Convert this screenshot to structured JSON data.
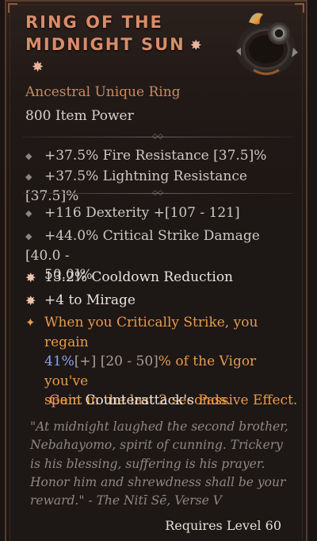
{
  "item": {
    "name": "Ring of the Midnight Sun",
    "name_line1": "RING OF THE",
    "name_line2": "MIDNIGHT SUN",
    "type": "Ancestral Unique Ring",
    "power": "800 Item Power"
  },
  "implicit_stats": [
    "+37.5% Fire Resistance [37.5]%",
    "+37.5% Lightning Resistance [37.5]%"
  ],
  "affixes": [
    {
      "line1": "+116 Dexterity +[107 - 121]"
    },
    {
      "line1": "+44.0% Critical Strike Damage [40.0 -",
      "line2": "50.0]%"
    },
    {
      "line1": "13.2% Cooldown Reduction"
    },
    {
      "line1": "+4 to Mirage"
    }
  ],
  "unique_power": {
    "line1": "When you Critically Strike, you regain",
    "value": "41%",
    "plus": "[+]",
    "range": " [20 - 50]",
    "rest2": "% of the Vigor you've",
    "line3": "spent in the last 2 seconds."
  },
  "passive": {
    "gain": "Gain",
    "skill": "Counterattack's",
    "effect": "Passive Effect."
  },
  "flavor": "\"At midnight laughed the second brother, Nebahayomo, spirit of cunning. Trickery is his blessing, suffering is his prayer. Honor him and shrewdness shall be your reward.\" - The Nitī Sē, Verse V",
  "requirement": "Requires Level 60",
  "colors": {
    "unique_title": "#d98c6a",
    "item_type": "#c98a62",
    "unique_power": "#e99a4a",
    "rolled_value": "#8ea2f2"
  }
}
